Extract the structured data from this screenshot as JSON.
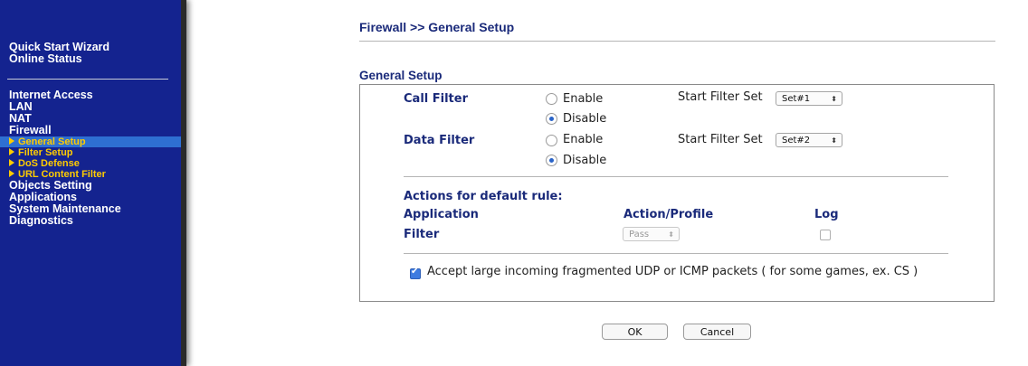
{
  "sidebar": {
    "group1": [
      "Quick Start Wizard",
      "Online Status"
    ],
    "group2": [
      "Internet Access",
      "LAN",
      "NAT",
      "Firewall"
    ],
    "firewall_sub": [
      "General Setup",
      "Filter Setup",
      "DoS Defense",
      "URL Content Filter"
    ],
    "active_sub": "General Setup",
    "group3": [
      "Objects Setting",
      "Applications",
      "System Maintenance",
      "Diagnostics"
    ]
  },
  "page": {
    "title": "Firewall >> General Setup",
    "section": "General Setup"
  },
  "call_filter": {
    "label": "Call Filter",
    "enable_label": "Enable",
    "disable_label": "Disable",
    "selected": "Disable",
    "start_label": "Start Filter Set",
    "start_value": "Set#1"
  },
  "data_filter": {
    "label": "Data Filter",
    "enable_label": "Enable",
    "disable_label": "Disable",
    "selected": "Disable",
    "start_label": "Start Filter Set",
    "start_value": "Set#2"
  },
  "actions": {
    "heading": "Actions for default rule:",
    "col_application": "Application",
    "col_action": "Action/Profile",
    "col_log": "Log",
    "row_label": "Filter",
    "row_action": "Pass",
    "row_log_checked": false
  },
  "fragment": {
    "checked": true,
    "label": "Accept large incoming fragmented UDP or ICMP packets ( for some games, ex. CS )"
  },
  "buttons": {
    "ok": "OK",
    "cancel": "Cancel"
  },
  "colors": {
    "sidebar_bg": "#14238f",
    "sub_item": "#ffcc00",
    "active_bg": "#2e6fd2",
    "heading": "#1a2a7a"
  }
}
